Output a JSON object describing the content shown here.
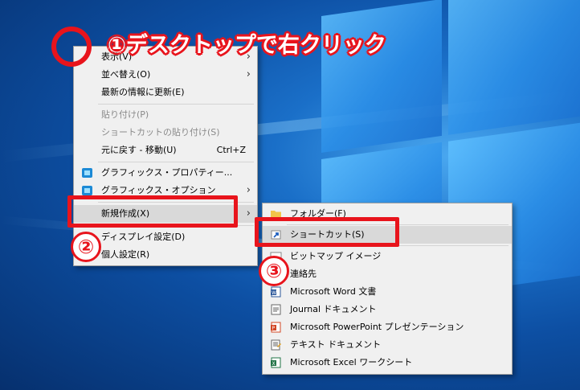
{
  "annotations": {
    "step1": "①デスクトップで右クリック",
    "step2": "②",
    "step3": "③"
  },
  "context_menu": {
    "items": [
      {
        "label": "表示(V)",
        "has_submenu": true,
        "disabled": false
      },
      {
        "label": "並べ替え(O)",
        "has_submenu": true,
        "disabled": false
      },
      {
        "label": "最新の情報に更新(E)",
        "disabled": false
      },
      {
        "label": "貼り付け(P)",
        "disabled": true
      },
      {
        "label": "ショートカットの貼り付け(S)",
        "disabled": true
      },
      {
        "label": "元に戻す - 移動(U)",
        "shortcut": "Ctrl+Z",
        "disabled": false
      },
      {
        "label": "グラフィックス・プロパティー...",
        "icon": "graphics-icon",
        "disabled": false
      },
      {
        "label": "グラフィックス・オプション",
        "icon": "graphics-icon",
        "has_submenu": true,
        "disabled": false
      },
      {
        "label": "新規作成(X)",
        "has_submenu": true,
        "highlighted": true,
        "disabled": false
      },
      {
        "label": "ディスプレイ設定(D)",
        "icon": "display-icon",
        "disabled": false
      },
      {
        "label": "個人設定(R)",
        "icon": "personalize-icon",
        "disabled": false
      }
    ]
  },
  "submenu": {
    "items": [
      {
        "label": "フォルダー(F)",
        "icon": "folder-icon"
      },
      {
        "label": "ショートカット(S)",
        "icon": "shortcut-icon",
        "highlighted": true
      },
      {
        "label": "ビットマップ イメージ",
        "icon": "bitmap-icon"
      },
      {
        "label": "連絡先",
        "icon": "contact-icon"
      },
      {
        "label": "Microsoft Word 文書",
        "icon": "word-icon"
      },
      {
        "label": "Journal ドキュメント",
        "icon": "journal-icon"
      },
      {
        "label": "Microsoft PowerPoint プレゼンテーション",
        "icon": "powerpoint-icon"
      },
      {
        "label": "テキスト ドキュメント",
        "icon": "text-document-icon"
      },
      {
        "label": "Microsoft Excel ワークシート",
        "icon": "excel-icon"
      }
    ]
  },
  "colors": {
    "annotation_red": "#e8141c",
    "menu_bg": "#f0f0f0",
    "highlight_bg": "#d9d9d9"
  }
}
